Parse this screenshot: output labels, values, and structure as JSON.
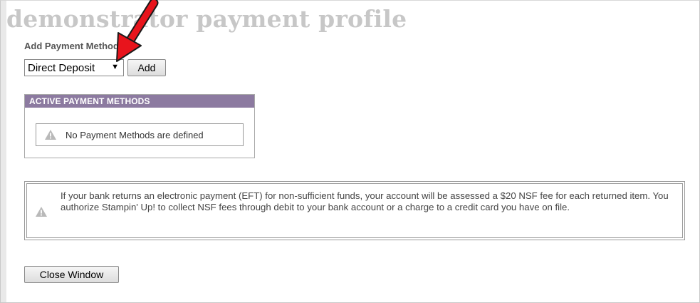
{
  "page": {
    "title": "demonstrator payment profile"
  },
  "add_method": {
    "label": "Add Payment Method",
    "selected_option": "Direct Deposit",
    "add_button": "Add"
  },
  "active_methods": {
    "header": "ACTIVE PAYMENT METHODS",
    "empty_message": "No Payment Methods are defined"
  },
  "nsf_notice": {
    "text": "If your bank returns an electronic payment (EFT) for non-sufficient funds, your account will be assessed a $20 NSF fee for each returned item.  You authorize Stampin' Up! to collect NSF fees through debit to your bank account or a charge to a credit card you have on file."
  },
  "footer": {
    "close_button": "Close Window"
  },
  "icons": {
    "warning": "warning-icon",
    "annotation": "red-arrow-icon"
  },
  "colors": {
    "header_bg": "#8c7aa0",
    "title_color": "#c7c7c7",
    "annotation_arrow": "#e8141c"
  }
}
